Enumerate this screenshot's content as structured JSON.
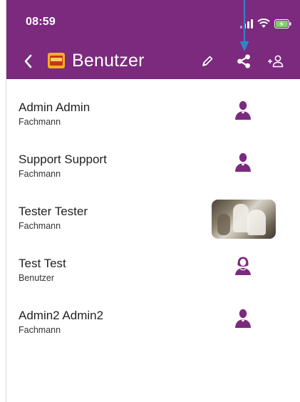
{
  "status_bar": {
    "time": "08:59"
  },
  "toolbar": {
    "title": "Benutzer",
    "icons": {
      "back": "chevron-left-icon",
      "logo": "heat-app-logo",
      "edit": "pencil-icon",
      "share": "share-icon",
      "add_user": "add-user-icon"
    }
  },
  "users": [
    {
      "name": "Admin Admin",
      "role": "Fachmann",
      "avatar": "male-user-icon"
    },
    {
      "name": "Support Support",
      "role": "Fachmann",
      "avatar": "male-user-icon"
    },
    {
      "name": "Tester Tester",
      "role": "Fachmann",
      "avatar": "photo-thumbnail"
    },
    {
      "name": "Test Test",
      "role": "Benutzer",
      "avatar": "female-user-icon"
    },
    {
      "name": "Admin2 Admin2",
      "role": "Fachmann",
      "avatar": "male-user-icon"
    }
  ],
  "colors": {
    "header": "#7b2a7e",
    "avatar": "#7b2a7e",
    "indicator_arrow": "#2f86c6"
  }
}
